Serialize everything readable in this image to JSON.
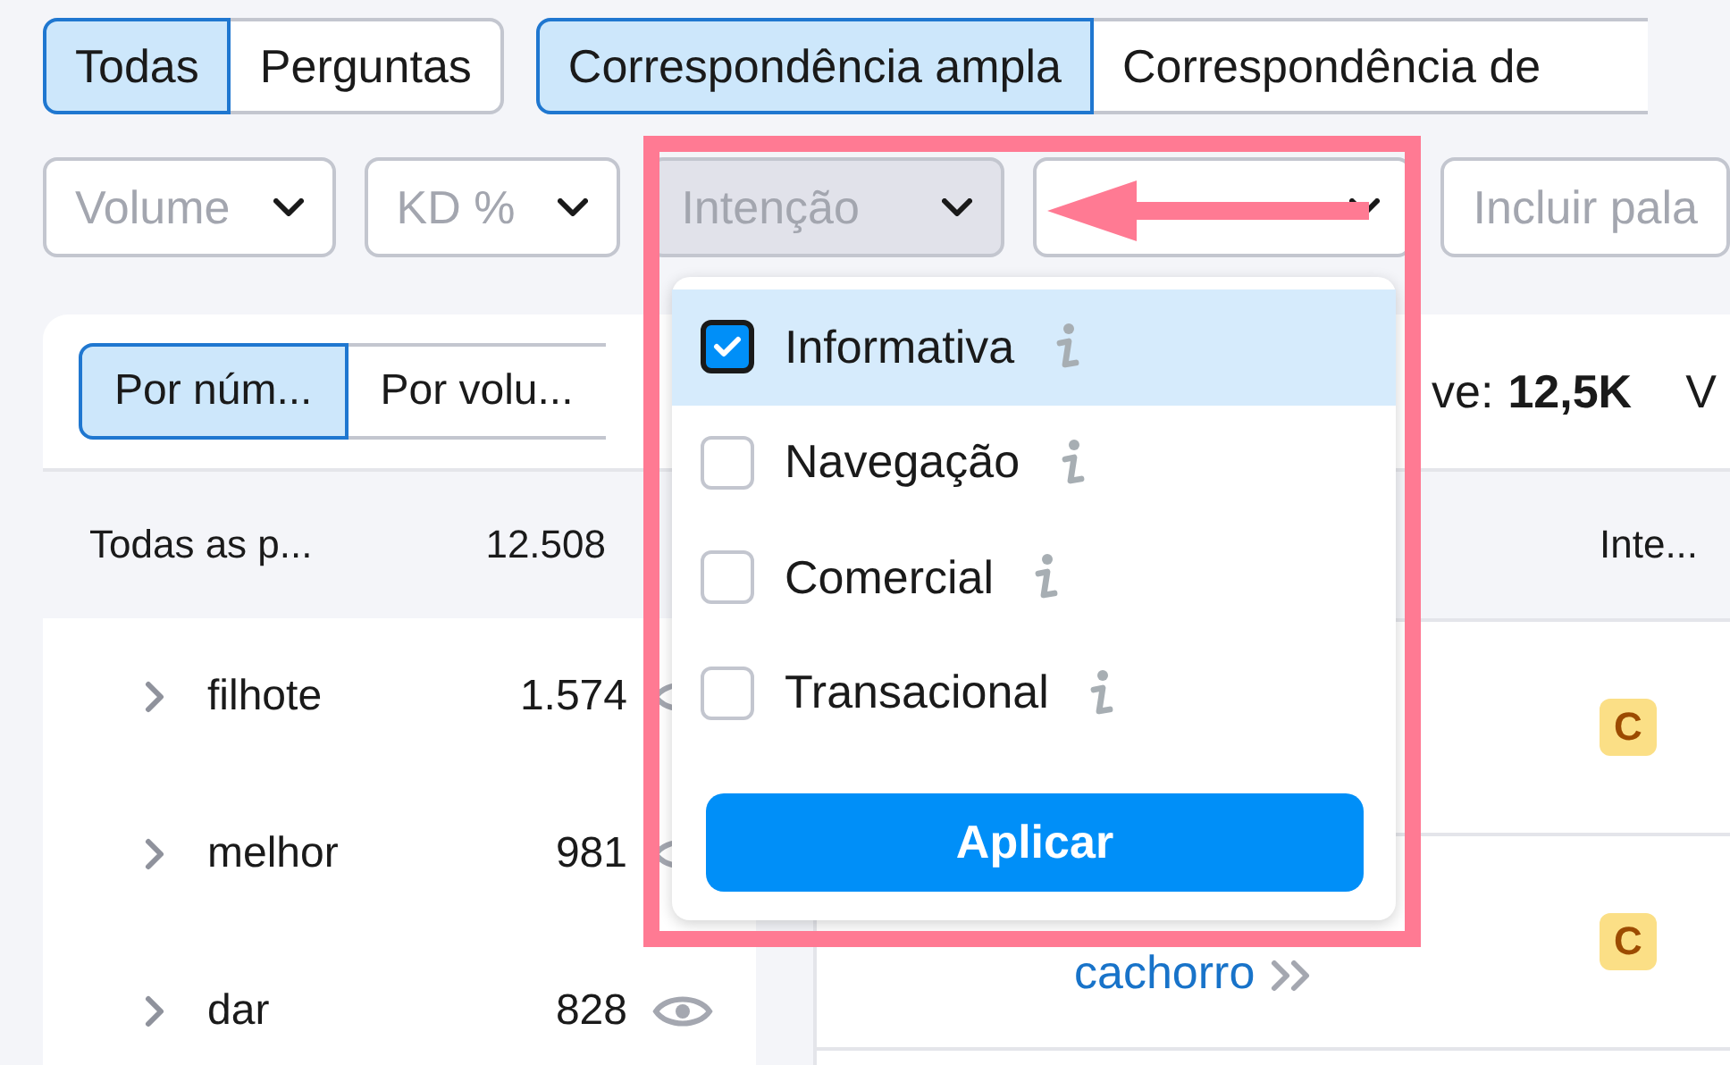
{
  "filter_type_tabs": [
    {
      "label": "Todas",
      "selected": true
    },
    {
      "label": "Perguntas",
      "selected": false
    }
  ],
  "match_tabs": [
    {
      "label": "Correspondência ampla",
      "selected": true
    },
    {
      "label": "Correspondência de",
      "selected": false
    }
  ],
  "filters": [
    {
      "kind": "dropdown",
      "label": "Volume",
      "active": false
    },
    {
      "kind": "dropdown",
      "label": "KD %",
      "active": false
    },
    {
      "kind": "dropdown",
      "label": "Intenção",
      "active": true
    },
    {
      "kind": "dropdown",
      "active": false
    },
    {
      "kind": "text",
      "label": "Incluir pala",
      "active": false
    }
  ],
  "groups_panel": {
    "sort_tabs": [
      {
        "label": "Por núm...",
        "selected": true
      },
      {
        "label": "Por volu...",
        "selected": false
      }
    ],
    "all_row": {
      "label": "Todas as p...",
      "count": "12.508"
    },
    "groups": [
      {
        "label": "filhote",
        "count": "1.574"
      },
      {
        "label": "melhor",
        "count": "981"
      },
      {
        "label": "dar",
        "count": "828"
      }
    ]
  },
  "results": {
    "summary_label": "ve:",
    "summary_value": "12,5K",
    "summary_next": "V",
    "columns": [
      "Inte..."
    ],
    "rows": [
      {
        "intent": "C"
      },
      {
        "keyword": "cachorro",
        "intent": "C"
      }
    ]
  },
  "intent_dropdown": {
    "options": [
      {
        "label": "Informativa",
        "checked": true
      },
      {
        "label": "Navegação",
        "checked": false
      },
      {
        "label": "Comercial",
        "checked": false
      },
      {
        "label": "Transacional",
        "checked": false
      }
    ],
    "apply_label": "Aplicar"
  }
}
